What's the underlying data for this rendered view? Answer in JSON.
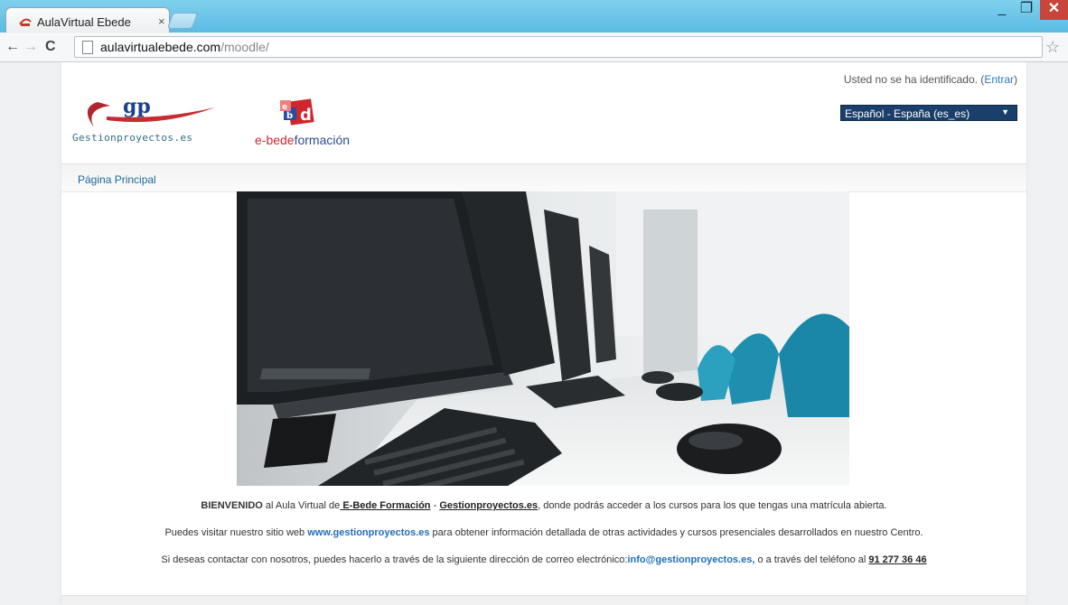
{
  "browser": {
    "tab_title": "AulaVirtual Ebede",
    "tab_close": "×",
    "url_host": "aulavirtualebede.com",
    "url_path": "/moodle/",
    "window_controls": {
      "minimize": "_",
      "maximize": "❐",
      "close": "✕"
    },
    "icons": {
      "back": "←",
      "forward": "→",
      "reload": "C",
      "star": "☆"
    }
  },
  "header": {
    "login_text": "Usted no se ha identificado. (",
    "login_link": "Entrar",
    "login_text_end": ")",
    "language": "Español - España (es_es)",
    "logo_gp_mark": "gp",
    "logo_gp_text": "Gestionproyectos.es",
    "logo_ebede_prefix": "e-bede",
    "logo_ebede_suffix": "formación"
  },
  "navbar": {
    "breadcrumb": "Página Principal"
  },
  "content": {
    "p1": {
      "bold": "BIENVENIDO",
      "t1": " al Aula Virtual de",
      "link1": " E-Bede Formación",
      "t2": " - ",
      "link2": "Gestionproyectos.es",
      "t3": ", donde podrás acceder a los cursos para los que tengas una matrícula abierta."
    },
    "p2": {
      "t1": "Puedes visitar nuestro sitio web ",
      "link": "www.gestionproyectos.es",
      "t2": " para obtener información detallada de otras actividades y cursos presenciales desarrollados en nuestro Centro."
    },
    "p3": {
      "t1": "Si deseas contactar con nosotros, puedes hacerlo a través de la siguiente dirección de correo electrónico:",
      "email": "info@gestionproyectos.es,",
      "t2": " o a través del teléfono al ",
      "phone": "91 277 36 46 "
    }
  },
  "colors": {
    "accent": "#1f6fb8",
    "lang_bg": "#1b3f6b",
    "brand_red": "#d0262e"
  }
}
